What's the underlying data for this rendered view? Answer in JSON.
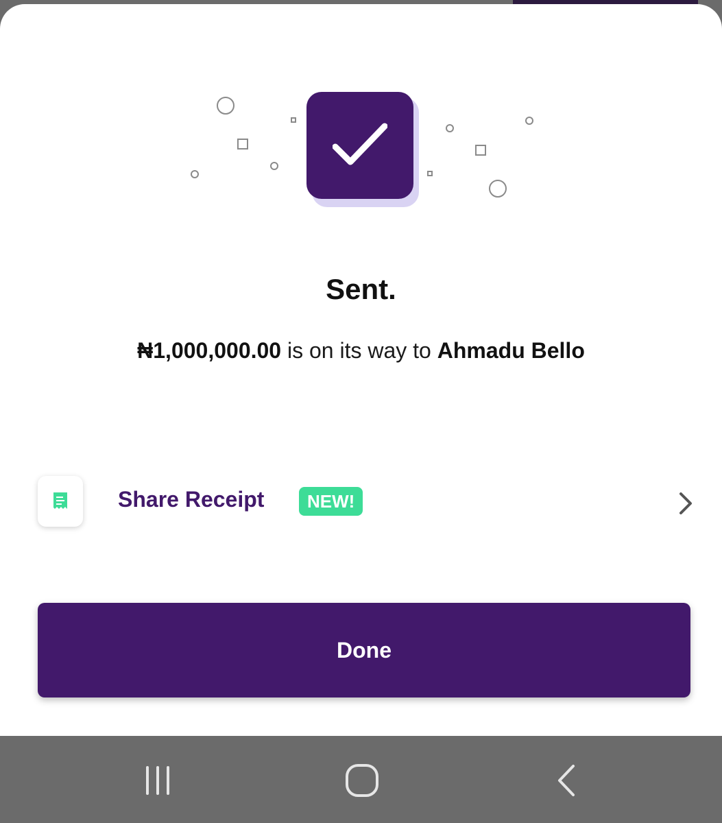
{
  "status": {
    "title": "Sent.",
    "amount": "₦1,000,000.00",
    "message_middle": " is on its way to ",
    "recipient": "Ahmadu Bello"
  },
  "share": {
    "label": "Share Receipt",
    "badge": "NEW!"
  },
  "actions": {
    "done_label": "Done"
  },
  "colors": {
    "brand_purple": "#42196b",
    "badge_green": "#3ddc97",
    "nav_bar": "#6b6b6b"
  },
  "icons": {
    "success": "checkmark-icon",
    "receipt": "receipt-icon",
    "row_chevron": "chevron-right-icon",
    "nav_recents": "recent-apps-icon",
    "nav_home": "home-icon",
    "nav_back": "back-icon"
  }
}
